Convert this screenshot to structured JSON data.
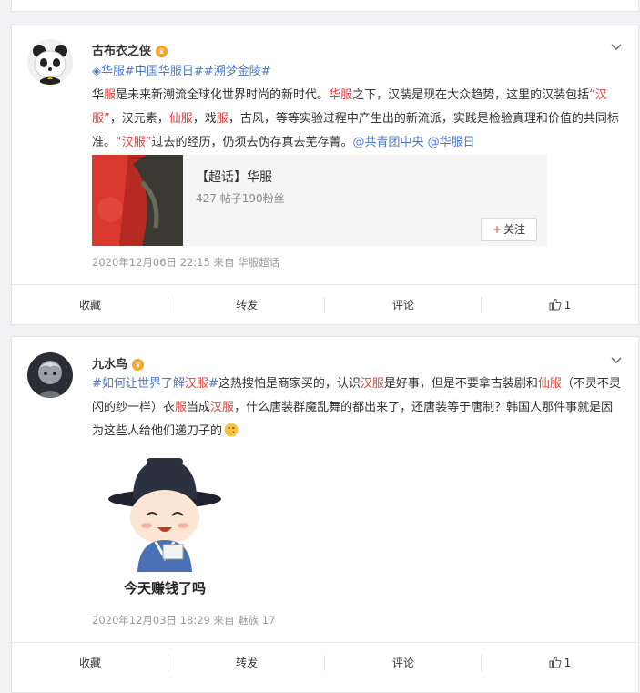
{
  "posts": [
    {
      "username": "古布衣之侠",
      "topics": [
        "华服",
        "#中国华服日#",
        "#溯梦金陵#"
      ],
      "text_parts": [
        {
          "t": "华",
          "c": "n"
        },
        {
          "t": "服",
          "c": "r"
        },
        {
          "t": "是未来新潮流全球化世界时尚的新时代。",
          "c": "n"
        },
        {
          "t": "华",
          "c": "r"
        },
        {
          "t": "服",
          "c": "r"
        },
        {
          "t": "之下，汉装是现在大众趋势，这里的汉装包括",
          "c": "n"
        },
        {
          "t": "“汉服”",
          "c": "r"
        },
        {
          "t": "，汉元素，",
          "c": "n"
        },
        {
          "t": "仙服",
          "c": "r"
        },
        {
          "t": "，戏",
          "c": "n"
        },
        {
          "t": "服",
          "c": "r"
        },
        {
          "t": "，古风，等等实验过程中产生出的新流派，实践是检验真理和价值的共同标准。",
          "c": "n"
        },
        {
          "t": "“汉服”",
          "c": "r"
        },
        {
          "t": "过去的经历，仍须去伪存真去芜存菁。",
          "c": "n"
        },
        {
          "t": "@共青团中央 @华服日",
          "c": "b"
        }
      ],
      "share_card": {
        "title": "【超话】华服",
        "subtitle": "427 帖子190粉丝",
        "follow_label": "关注"
      },
      "meta": "2020年12月06日 22:15  来自 华服超话",
      "actions": {
        "favorite": "收藏",
        "repost": "转发",
        "comment": "评论",
        "like": "1"
      }
    },
    {
      "username": "九水鸟",
      "text_parts": [
        {
          "t": "#如何让世界了解",
          "c": "b"
        },
        {
          "t": "汉服",
          "c": "r"
        },
        {
          "t": "#",
          "c": "b"
        },
        {
          "t": "这热搜怕是商家买的，认识",
          "c": "n"
        },
        {
          "t": "汉服",
          "c": "r"
        },
        {
          "t": "是好事，但是不要拿古装剧和",
          "c": "n"
        },
        {
          "t": "仙服",
          "c": "r"
        },
        {
          "t": "（不灵不灵闪的纱一样）衣",
          "c": "n"
        },
        {
          "t": "服",
          "c": "r"
        },
        {
          "t": "当成",
          "c": "n"
        },
        {
          "t": "汉服",
          "c": "r"
        },
        {
          "t": "，什么唐装群魔乱舞的都出来了，还唐装等于唐制？韩国人那件事就是因为这些人给他们递刀子的",
          "c": "n"
        }
      ],
      "sticker_caption": "今天赚钱了吗",
      "meta": "2020年12月03日 18:29  来自 魅族 17",
      "actions": {
        "favorite": "收藏",
        "repost": "转发",
        "comment": "评论",
        "like": "1"
      }
    }
  ],
  "colors": {
    "accent_red": "#e2443d",
    "link_blue": "#4c79c8",
    "crown": "#f6a623"
  }
}
